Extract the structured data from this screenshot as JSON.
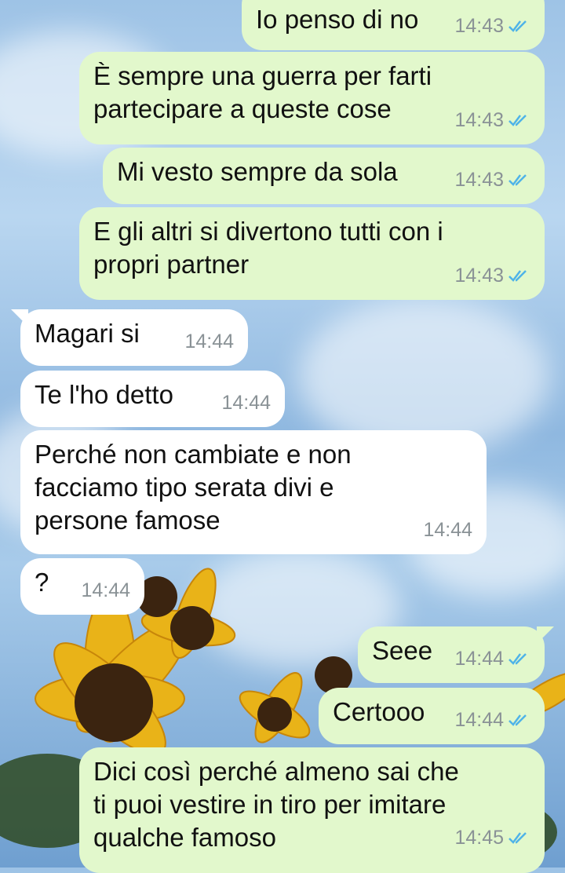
{
  "colors": {
    "outgoing_bubble": "#e2f8cc",
    "incoming_bubble": "#ffffff",
    "read_ticks": "#4fb3e8",
    "timestamp": "#8a9296"
  },
  "messages": [
    {
      "direction": "out",
      "text": "Io penso di no",
      "time": "14:43",
      "status": "read"
    },
    {
      "direction": "out",
      "text": "È sempre una guerra per farti\npartecipare a queste cose",
      "time": "14:43",
      "status": "read"
    },
    {
      "direction": "out",
      "text": "Mi vesto sempre da sola",
      "time": "14:43",
      "status": "read"
    },
    {
      "direction": "out",
      "text": "E gli altri si divertono tutti con i\npropri partner",
      "time": "14:43",
      "status": "read"
    },
    {
      "direction": "in",
      "text": "Magari si",
      "time": "14:44"
    },
    {
      "direction": "in",
      "text": "Te l'ho detto",
      "time": "14:44"
    },
    {
      "direction": "in",
      "text": "Perché non cambiate e non\nfacciamo tipo serata divi e\npersone famose",
      "time": "14:44"
    },
    {
      "direction": "in",
      "text": "?",
      "time": "14:44"
    },
    {
      "direction": "out",
      "text": "Seee",
      "time": "14:44",
      "status": "read"
    },
    {
      "direction": "out",
      "text": "Certooo",
      "time": "14:44",
      "status": "read"
    },
    {
      "direction": "out",
      "text": "Dici così perché almeno sai che\nti puoi vestire in tiro per imitare\nqualche famoso",
      "time": "14:45",
      "status": "read"
    }
  ]
}
